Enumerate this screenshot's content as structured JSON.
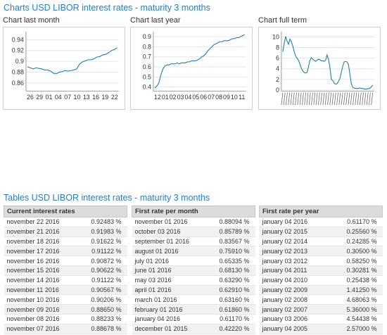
{
  "charts_heading": "Charts USD LIBOR interest rates - maturity 3 months",
  "tables_heading": "Tables USD LIBOR interest rates - maturity 3 months",
  "chart_data": [
    {
      "type": "line",
      "title": "Chart last month",
      "x_ticks": [
        "26",
        "29",
        "01",
        "04",
        "07",
        "10",
        "13",
        "16",
        "19",
        "22"
      ],
      "y_ticks": [
        0.86,
        0.88,
        0.9,
        0.92,
        0.94
      ],
      "ylim": [
        0.845,
        0.955
      ],
      "color": "#1a7fa8",
      "values": [
        0.89,
        0.888,
        0.886,
        0.888,
        0.887,
        0.886,
        0.884,
        0.884,
        0.882,
        0.878,
        0.877,
        0.88,
        0.881,
        0.883,
        0.882,
        0.883,
        0.884,
        0.886,
        0.895,
        0.899,
        0.901,
        0.903,
        0.903,
        0.905,
        0.908,
        0.909,
        0.912,
        0.913,
        0.916,
        0.92,
        0.922,
        0.925
      ]
    },
    {
      "type": "line",
      "title": "Chart last year",
      "x_ticks": [
        "12",
        "01",
        "02",
        "03",
        "04",
        "05",
        "06",
        "07",
        "08",
        "09",
        "10",
        "11"
      ],
      "y_ticks": [
        0.4,
        0.5,
        0.6,
        0.7,
        0.8,
        0.9
      ],
      "ylim": [
        0.36,
        0.95
      ],
      "color": "#1a7fa8",
      "values": [
        0.39,
        0.41,
        0.44,
        0.52,
        0.58,
        0.61,
        0.62,
        0.62,
        0.63,
        0.63,
        0.63,
        0.64,
        0.63,
        0.64,
        0.64,
        0.64,
        0.65,
        0.65,
        0.66,
        0.66,
        0.66,
        0.67,
        0.68,
        0.7,
        0.71,
        0.73,
        0.76,
        0.78,
        0.8,
        0.82,
        0.83,
        0.84,
        0.85,
        0.85,
        0.86,
        0.86,
        0.86,
        0.87,
        0.88,
        0.88,
        0.89,
        0.89,
        0.9,
        0.91,
        0.92
      ]
    },
    {
      "type": "line",
      "title": "Chart full term",
      "y_ticks": [
        0,
        2,
        4,
        6,
        8,
        10
      ],
      "ylim": [
        -0.2,
        11
      ],
      "color": "#1a7fa8",
      "values": [
        7.2,
        8.8,
        10.1,
        9.2,
        8.6,
        9.6,
        9.1,
        8.3,
        7.2,
        6.4,
        6.0,
        5.6,
        4.9,
        4.1,
        3.6,
        3.3,
        3.2,
        3.3,
        4.4,
        5.6,
        6.1,
        5.8,
        5.6,
        5.4,
        5.6,
        5.8,
        5.7,
        5.5,
        5.5,
        5.4,
        5.6,
        6.6,
        5.8,
        4.3,
        2.0,
        1.8,
        1.3,
        1.1,
        1.2,
        1.6,
        2.2,
        3.3,
        4.5,
        5.3,
        5.4,
        5.3,
        4.8,
        3.0,
        1.2,
        0.5,
        0.4,
        0.3,
        0.3,
        0.3,
        0.4,
        0.3,
        0.3,
        0.2,
        0.2,
        0.2,
        0.3,
        0.3,
        0.6,
        0.9
      ]
    }
  ],
  "tables": [
    {
      "header": "Current interest rates",
      "rows": [
        {
          "date": "november 22 2016",
          "rate": "0.92483 %"
        },
        {
          "date": "november 21 2016",
          "rate": "0.91983 %"
        },
        {
          "date": "november 18 2016",
          "rate": "0.91622 %"
        },
        {
          "date": "november 17 2016",
          "rate": "0.91122 %"
        },
        {
          "date": "november 16 2016",
          "rate": "0.90872 %"
        },
        {
          "date": "november 15 2016",
          "rate": "0.90622 %"
        },
        {
          "date": "november 14 2016",
          "rate": "0.91122 %"
        },
        {
          "date": "november 11 2016",
          "rate": "0.90567 %"
        },
        {
          "date": "november 10 2016",
          "rate": "0.90206 %"
        },
        {
          "date": "november 09 2016",
          "rate": "0.88650 %"
        },
        {
          "date": "november 08 2016",
          "rate": "0.88233 %"
        },
        {
          "date": "november 07 2016",
          "rate": "0.88678 %"
        }
      ]
    },
    {
      "header": "First rate per month",
      "rows": [
        {
          "date": "november 01 2016",
          "rate": "0.88094 %"
        },
        {
          "date": "october 03 2016",
          "rate": "0.85789 %"
        },
        {
          "date": "september 01 2016",
          "rate": "0.83567 %"
        },
        {
          "date": "august 01 2016",
          "rate": "0.75910 %"
        },
        {
          "date": "july 01 2016",
          "rate": "0.65335 %"
        },
        {
          "date": "june 01 2016",
          "rate": "0.68130 %"
        },
        {
          "date": "may 03 2016",
          "rate": "0.63290 %"
        },
        {
          "date": "april 01 2016",
          "rate": "0.62910 %"
        },
        {
          "date": "march 01 2016",
          "rate": "0.63160 %"
        },
        {
          "date": "february 01 2016",
          "rate": "0.61860 %"
        },
        {
          "date": "january 04 2016",
          "rate": "0.61170 %"
        },
        {
          "date": "december 01 2015",
          "rate": "0.42220 %"
        }
      ]
    },
    {
      "header": "First rate per year",
      "rows": [
        {
          "date": "january 04 2016",
          "rate": "0.61170 %"
        },
        {
          "date": "january 02 2015",
          "rate": "0.25560 %"
        },
        {
          "date": "january 02 2014",
          "rate": "0.24285 %"
        },
        {
          "date": "january 02 2013",
          "rate": "0.30500 %"
        },
        {
          "date": "january 03 2012",
          "rate": "0.58250 %"
        },
        {
          "date": "january 04 2011",
          "rate": "0.30281 %"
        },
        {
          "date": "january 04 2010",
          "rate": "0.25438 %"
        },
        {
          "date": "january 02 2009",
          "rate": "1.41250 %"
        },
        {
          "date": "january 02 2008",
          "rate": "4.68063 %"
        },
        {
          "date": "january 02 2007",
          "rate": "5.36000 %"
        },
        {
          "date": "january 03 2006",
          "rate": "4.54438 %"
        },
        {
          "date": "january 04 2005",
          "rate": "2.57000 %"
        }
      ]
    }
  ]
}
